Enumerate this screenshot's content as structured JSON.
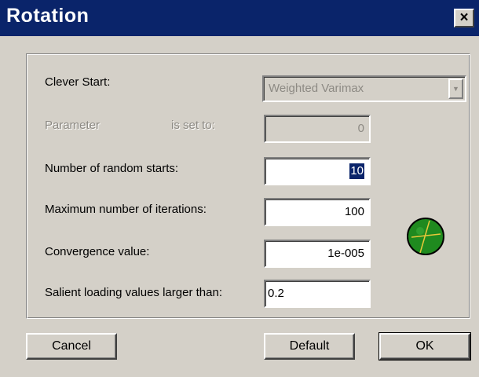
{
  "window": {
    "title": "Rotation",
    "close_symbol": "×"
  },
  "clever_start": {
    "label": "Clever Start:",
    "value": "Weighted Varimax",
    "arrow": "▼"
  },
  "parameter": {
    "label": "Parameter",
    "suffix": "is set to:",
    "value": "0"
  },
  "random_starts": {
    "label": "Number of random starts:",
    "value": "10"
  },
  "max_iterations": {
    "label": "Maximum number of iterations:",
    "value": "100"
  },
  "convergence": {
    "label": "Convergence value:",
    "value": "1e-005"
  },
  "salient_loading": {
    "label": "Salient loading values larger than:",
    "value": "0.2"
  },
  "status_icon": {
    "name": "globe-icon",
    "color": "#1f8a1f"
  },
  "buttons": {
    "cancel": "Cancel",
    "default": "Default",
    "ok": "OK"
  }
}
